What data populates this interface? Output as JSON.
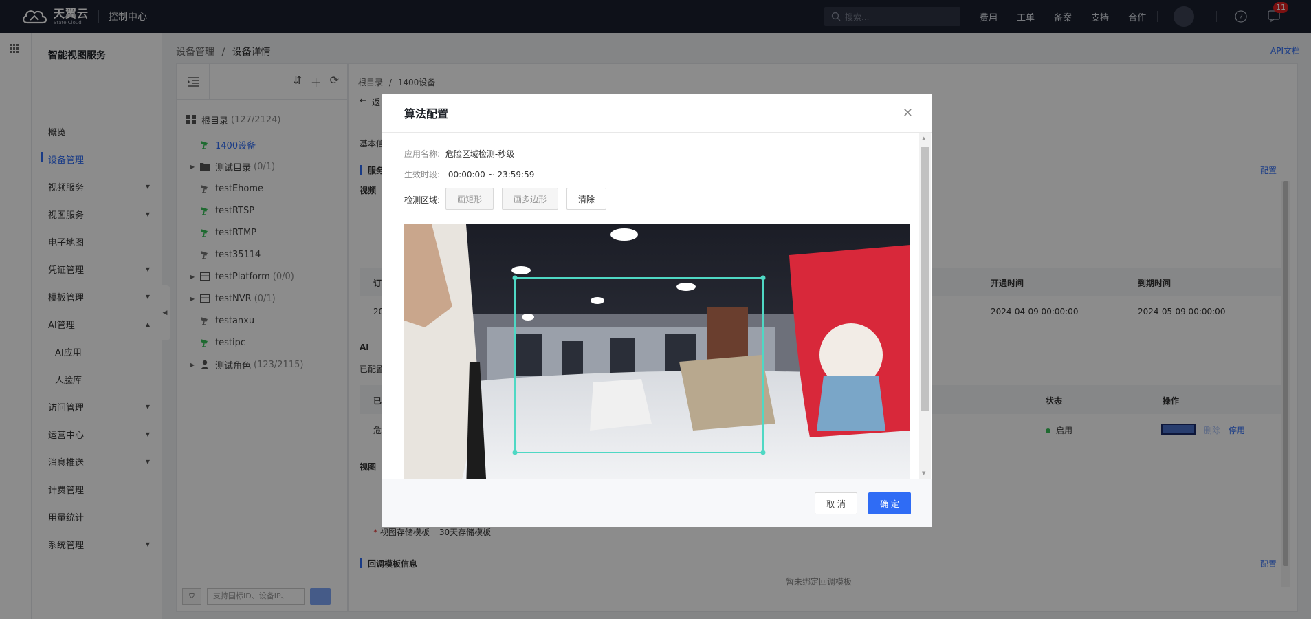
{
  "topbar": {
    "logo_cn": "天翼云",
    "logo_en": "State Cloud",
    "console": "控制中心",
    "search_placeholder": "搜索...",
    "nav": [
      "费用",
      "工单",
      "备案",
      "支持",
      "合作"
    ],
    "message_count": "11"
  },
  "sidebar": {
    "title": "智能视图服务",
    "items": [
      {
        "label": "概览",
        "expandable": false
      },
      {
        "label": "设备管理",
        "expandable": false,
        "active": true
      },
      {
        "label": "视频服务",
        "expandable": true
      },
      {
        "label": "视图服务",
        "expandable": true
      },
      {
        "label": "电子地图",
        "expandable": false
      },
      {
        "label": "凭证管理",
        "expandable": true
      },
      {
        "label": "模板管理",
        "expandable": true
      },
      {
        "label": "AI管理",
        "expandable": true,
        "open": true
      },
      {
        "label": "AI应用",
        "expandable": false,
        "sub": true
      },
      {
        "label": "人脸库",
        "expandable": false,
        "sub": true
      },
      {
        "label": "访问管理",
        "expandable": true
      },
      {
        "label": "运营中心",
        "expandable": true
      },
      {
        "label": "消息推送",
        "expandable": true
      },
      {
        "label": "计费管理",
        "expandable": false
      },
      {
        "label": "用量统计",
        "expandable": false
      },
      {
        "label": "系统管理",
        "expandable": true
      }
    ]
  },
  "breadcrumb": {
    "parent": "设备管理",
    "sep": "/",
    "current": "设备详情"
  },
  "api_doc": "API文档",
  "tree": {
    "root_label": "根目录",
    "root_count": "(127/2124)",
    "nodes": [
      {
        "label": "1400设备",
        "count": "",
        "type": "camera-green",
        "indent": 0,
        "selected": true
      },
      {
        "label": "测试目录",
        "count": "(0/1)",
        "type": "folder",
        "indent": 0,
        "expandable": true
      },
      {
        "label": "testEhome",
        "count": "",
        "type": "camera-gray",
        "indent": 0
      },
      {
        "label": "testRTSP",
        "count": "",
        "type": "camera-green",
        "indent": 0
      },
      {
        "label": "testRTMP",
        "count": "",
        "type": "camera-green",
        "indent": 0
      },
      {
        "label": "test35114",
        "count": "",
        "type": "camera-gray",
        "indent": 0
      },
      {
        "label": "testPlatform",
        "count": "(0/0)",
        "type": "nvr",
        "indent": 0,
        "expandable": true
      },
      {
        "label": "testNVR",
        "count": "(0/1)",
        "type": "nvr",
        "indent": 0,
        "expandable": true
      },
      {
        "label": "testanxu",
        "count": "",
        "type": "camera-gray",
        "indent": 0
      },
      {
        "label": "testipc",
        "count": "",
        "type": "camera-green",
        "indent": 0
      },
      {
        "label": "测试角色",
        "count": "(123/2115)",
        "type": "user",
        "indent": 0,
        "expandable": true
      }
    ],
    "search_placeholder": "支持国标ID、设备IP、"
  },
  "main": {
    "crumb_root": "根目录",
    "crumb_sep": "/",
    "crumb_current": "1400设备",
    "back_partial": "返",
    "basic_partial": "基本信",
    "service_partial": "服务",
    "video_partial": "视频",
    "config_link": "配置",
    "order_partial": "订",
    "order_value_partial": "20",
    "col_open_time": "开通时间",
    "col_expire_time": "到期时间",
    "open_time": "2024-04-09 00:00:00",
    "expire_time": "2024-05-09 00:00:00",
    "ai_partial": "AI",
    "configured_partial": "已配置",
    "app_col_partial": "已",
    "col_status": "状态",
    "col_ops": "操作",
    "row_name_partial": "危",
    "status_value": "启用",
    "op_delete": "删除",
    "op_stop": "停用",
    "view_partial": "视图",
    "storage_label": "视图存储模板",
    "storage_value": "30天存储模板",
    "callback_title": "回调模板信息",
    "callback_config": "配置",
    "callback_empty": "暂未绑定回调模板"
  },
  "modal": {
    "title": "算法配置",
    "app_name_label": "应用名称:",
    "app_name": "危险区域检测-秒级",
    "time_label": "生效时段:",
    "time_value": "00:00:00 ~ 23:59:59",
    "region_label": "检测区域:",
    "btn_rect": "画矩形",
    "btn_polygon": "画多边形",
    "btn_clear": "清除",
    "detection_box_color": "#4fd8c4",
    "cancel": "取 消",
    "confirm": "确 定"
  },
  "colors": {
    "accent": "#2f6cf5",
    "topbar": "#1a1f2e",
    "online": "#3ac25a"
  }
}
